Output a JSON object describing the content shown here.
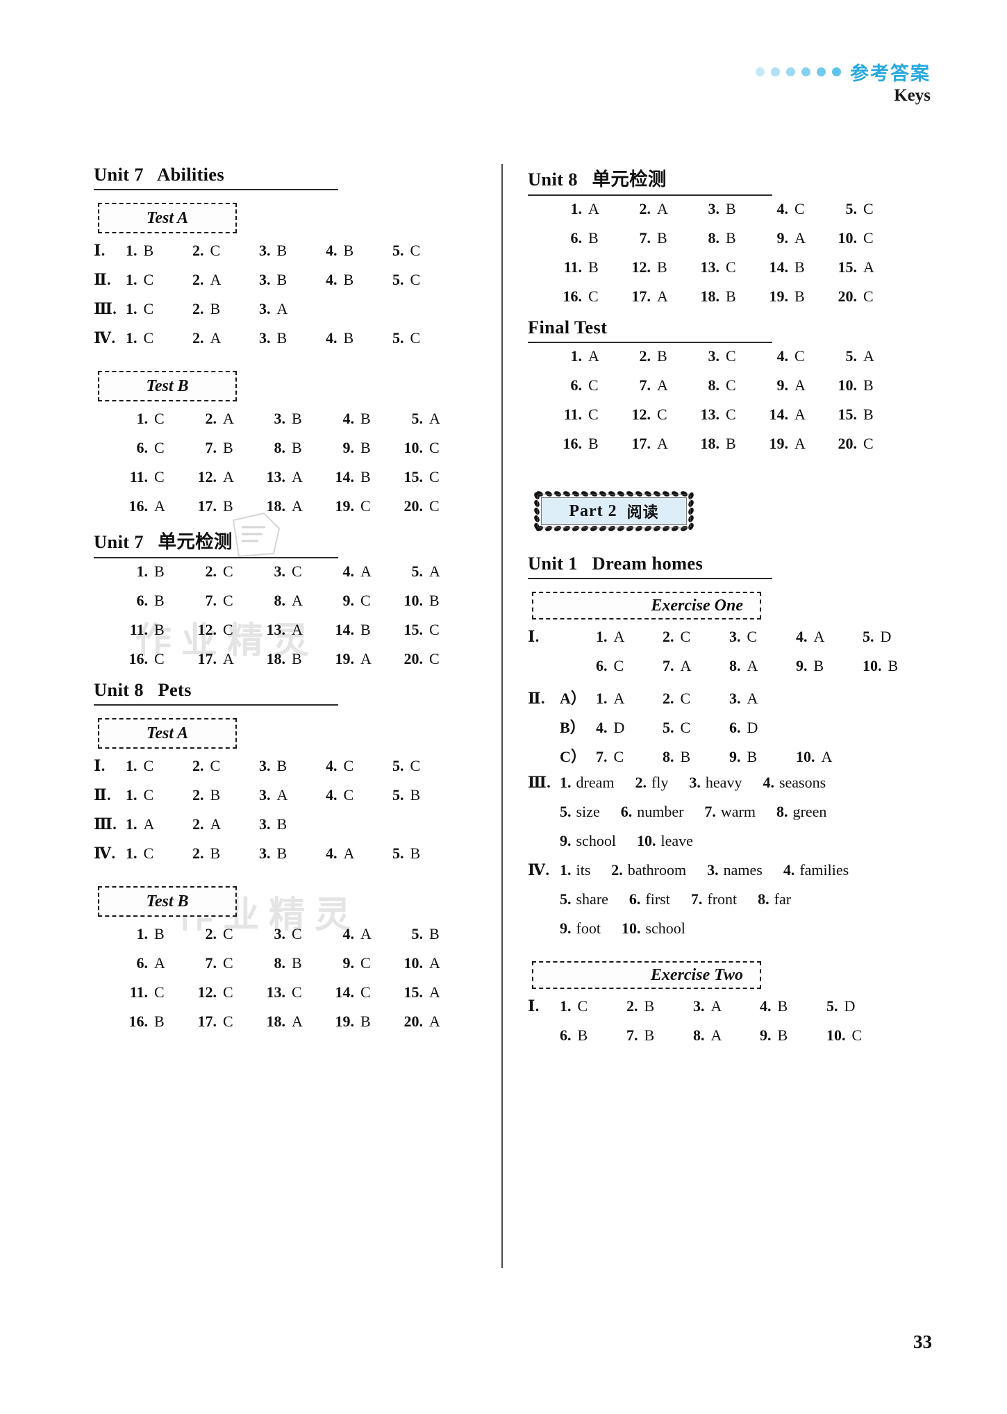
{
  "header": {
    "cn_title": "参考答案",
    "keys_label": "Keys",
    "accent_color": "#27a9e0",
    "dot_count": 6
  },
  "page_number": "33",
  "watermarks": [
    "作业精灵",
    "作业精灵",
    "作业"
  ],
  "left_column": [
    {
      "type": "unit-heading",
      "name": "unit-7-abilities",
      "text": "Unit 7   Abilities"
    },
    {
      "type": "test-label",
      "name": "test-a",
      "text": "Test A"
    },
    {
      "type": "answer-rows",
      "name": "unit7-test-a-answers",
      "rows": [
        {
          "roman": "Ⅰ.",
          "items": [
            [
              "1.",
              "B"
            ],
            [
              "2.",
              "C"
            ],
            [
              "3.",
              "B"
            ],
            [
              "4.",
              "B"
            ],
            [
              "5.",
              "C"
            ]
          ]
        },
        {
          "roman": "Ⅱ.",
          "items": [
            [
              "1.",
              "C"
            ],
            [
              "2.",
              "A"
            ],
            [
              "3.",
              "B"
            ],
            [
              "4.",
              "B"
            ],
            [
              "5.",
              "C"
            ]
          ]
        },
        {
          "roman": "Ⅲ.",
          "items": [
            [
              "1.",
              "C"
            ],
            [
              "2.",
              "B"
            ],
            [
              "3.",
              "A"
            ]
          ]
        },
        {
          "roman": "Ⅳ.",
          "items": [
            [
              "1.",
              "C"
            ],
            [
              "2.",
              "A"
            ],
            [
              "3.",
              "B"
            ],
            [
              "4.",
              "B"
            ],
            [
              "5.",
              "C"
            ]
          ]
        }
      ]
    },
    {
      "type": "test-label",
      "name": "test-b",
      "text": "Test B"
    },
    {
      "type": "grid-rows",
      "name": "unit7-test-b-answers",
      "rows": [
        [
          [
            "1.",
            "C"
          ],
          [
            "2.",
            "A"
          ],
          [
            "3.",
            "B"
          ],
          [
            "4.",
            "B"
          ],
          [
            "5.",
            "A"
          ]
        ],
        [
          [
            "6.",
            "C"
          ],
          [
            "7.",
            "B"
          ],
          [
            "8.",
            "B"
          ],
          [
            "9.",
            "B"
          ],
          [
            "10.",
            "C"
          ]
        ],
        [
          [
            "11.",
            "C"
          ],
          [
            "12.",
            "A"
          ],
          [
            "13.",
            "A"
          ],
          [
            "14.",
            "B"
          ],
          [
            "15.",
            "C"
          ]
        ],
        [
          [
            "16.",
            "A"
          ],
          [
            "17.",
            "B"
          ],
          [
            "18.",
            "A"
          ],
          [
            "19.",
            "C"
          ],
          [
            "20.",
            "C"
          ]
        ]
      ]
    },
    {
      "type": "unit-heading",
      "name": "unit-7-unit-test",
      "text": "Unit 7   单元检测"
    },
    {
      "type": "grid-rows",
      "name": "unit7-unit-test-answers",
      "rows": [
        [
          [
            "1.",
            "B"
          ],
          [
            "2.",
            "C"
          ],
          [
            "3.",
            "C"
          ],
          [
            "4.",
            "A"
          ],
          [
            "5.",
            "A"
          ]
        ],
        [
          [
            "6.",
            "B"
          ],
          [
            "7.",
            "C"
          ],
          [
            "8.",
            "A"
          ],
          [
            "9.",
            "C"
          ],
          [
            "10.",
            "B"
          ]
        ],
        [
          [
            "11.",
            "B"
          ],
          [
            "12.",
            "C"
          ],
          [
            "13.",
            "A"
          ],
          [
            "14.",
            "B"
          ],
          [
            "15.",
            "C"
          ]
        ],
        [
          [
            "16.",
            "C"
          ],
          [
            "17.",
            "A"
          ],
          [
            "18.",
            "B"
          ],
          [
            "19.",
            "A"
          ],
          [
            "20.",
            "C"
          ]
        ]
      ]
    },
    {
      "type": "unit-heading",
      "name": "unit-8-pets",
      "text": "Unit 8   Pets"
    },
    {
      "type": "test-label",
      "name": "test-a",
      "text": "Test A"
    },
    {
      "type": "answer-rows",
      "name": "unit8-test-a-answers",
      "rows": [
        {
          "roman": "Ⅰ.",
          "items": [
            [
              "1.",
              "C"
            ],
            [
              "2.",
              "C"
            ],
            [
              "3.",
              "B"
            ],
            [
              "4.",
              "C"
            ],
            [
              "5.",
              "C"
            ]
          ]
        },
        {
          "roman": "Ⅱ.",
          "items": [
            [
              "1.",
              "C"
            ],
            [
              "2.",
              "B"
            ],
            [
              "3.",
              "A"
            ],
            [
              "4.",
              "C"
            ],
            [
              "5.",
              "B"
            ]
          ]
        },
        {
          "roman": "Ⅲ.",
          "items": [
            [
              "1.",
              "A"
            ],
            [
              "2.",
              "A"
            ],
            [
              "3.",
              "B"
            ]
          ]
        },
        {
          "roman": "Ⅳ.",
          "items": [
            [
              "1.",
              "C"
            ],
            [
              "2.",
              "B"
            ],
            [
              "3.",
              "B"
            ],
            [
              "4.",
              "A"
            ],
            [
              "5.",
              "B"
            ]
          ]
        }
      ]
    },
    {
      "type": "test-label",
      "name": "test-b",
      "text": "Test B"
    },
    {
      "type": "grid-rows",
      "name": "unit8-test-b-answers",
      "rows": [
        [
          [
            "1.",
            "B"
          ],
          [
            "2.",
            "C"
          ],
          [
            "3.",
            "C"
          ],
          [
            "4.",
            "A"
          ],
          [
            "5.",
            "B"
          ]
        ],
        [
          [
            "6.",
            "A"
          ],
          [
            "7.",
            "C"
          ],
          [
            "8.",
            "B"
          ],
          [
            "9.",
            "C"
          ],
          [
            "10.",
            "A"
          ]
        ],
        [
          [
            "11.",
            "C"
          ],
          [
            "12.",
            "C"
          ],
          [
            "13.",
            "C"
          ],
          [
            "14.",
            "C"
          ],
          [
            "15.",
            "A"
          ]
        ],
        [
          [
            "16.",
            "B"
          ],
          [
            "17.",
            "C"
          ],
          [
            "18.",
            "A"
          ],
          [
            "19.",
            "B"
          ],
          [
            "20.",
            "A"
          ]
        ]
      ]
    }
  ],
  "right_column": [
    {
      "type": "unit-heading",
      "name": "unit-8-unit-test",
      "text": "Unit 8   单元检测"
    },
    {
      "type": "grid-rows",
      "name": "unit8-unit-test-answers",
      "rows": [
        [
          [
            "1.",
            "A"
          ],
          [
            "2.",
            "A"
          ],
          [
            "3.",
            "B"
          ],
          [
            "4.",
            "C"
          ],
          [
            "5.",
            "C"
          ]
        ],
        [
          [
            "6.",
            "B"
          ],
          [
            "7.",
            "B"
          ],
          [
            "8.",
            "B"
          ],
          [
            "9.",
            "A"
          ],
          [
            "10.",
            "C"
          ]
        ],
        [
          [
            "11.",
            "B"
          ],
          [
            "12.",
            "B"
          ],
          [
            "13.",
            "C"
          ],
          [
            "14.",
            "B"
          ],
          [
            "15.",
            "A"
          ]
        ],
        [
          [
            "16.",
            "C"
          ],
          [
            "17.",
            "A"
          ],
          [
            "18.",
            "B"
          ],
          [
            "19.",
            "B"
          ],
          [
            "20.",
            "C"
          ]
        ]
      ]
    },
    {
      "type": "unit-heading",
      "name": "final-test",
      "text": "Final Test"
    },
    {
      "type": "grid-rows",
      "name": "final-test-answers",
      "rows": [
        [
          [
            "1.",
            "A"
          ],
          [
            "2.",
            "B"
          ],
          [
            "3.",
            "C"
          ],
          [
            "4.",
            "C"
          ],
          [
            "5.",
            "A"
          ]
        ],
        [
          [
            "6.",
            "C"
          ],
          [
            "7.",
            "A"
          ],
          [
            "8.",
            "C"
          ],
          [
            "9.",
            "A"
          ],
          [
            "10.",
            "B"
          ]
        ],
        [
          [
            "11.",
            "C"
          ],
          [
            "12.",
            "C"
          ],
          [
            "13.",
            "C"
          ],
          [
            "14.",
            "A"
          ],
          [
            "15.",
            "B"
          ]
        ],
        [
          [
            "16.",
            "B"
          ],
          [
            "17.",
            "A"
          ],
          [
            "18.",
            "B"
          ],
          [
            "19.",
            "A"
          ],
          [
            "20.",
            "C"
          ]
        ]
      ]
    },
    {
      "type": "part-banner",
      "name": "part-2-banner",
      "label": "Part 2",
      "cn": "阅读",
      "fill_color": "#ddeef8"
    },
    {
      "type": "unit-heading",
      "name": "unit-1-dream-homes",
      "text": "Unit 1   Dream homes"
    },
    {
      "type": "test-label",
      "name": "exercise-one",
      "text": "Exercise One"
    },
    {
      "type": "answer-rows",
      "name": "exercise-one-answers",
      "rows": [
        {
          "roman": "Ⅰ.",
          "items": [
            [
              "1.",
              "A"
            ],
            [
              "2.",
              "C"
            ],
            [
              "3.",
              "C"
            ],
            [
              "4.",
              "A"
            ],
            [
              "5.",
              "D"
            ]
          ]
        },
        {
          "roman": "",
          "items": [
            [
              "6.",
              "C"
            ],
            [
              "7.",
              "A"
            ],
            [
              "8.",
              "A"
            ],
            [
              "9.",
              "B"
            ],
            [
              "10.",
              "B"
            ]
          ]
        },
        {
          "roman": "Ⅱ.",
          "sub": "A）",
          "items": [
            [
              "1.",
              "A"
            ],
            [
              "2.",
              "C"
            ],
            [
              "3.",
              "A"
            ]
          ]
        },
        {
          "roman": "",
          "sub": "B）",
          "items": [
            [
              "4.",
              "D"
            ],
            [
              "5.",
              "C"
            ],
            [
              "6.",
              "D"
            ]
          ]
        },
        {
          "roman": "",
          "sub": "C）",
          "items": [
            [
              "7.",
              "C"
            ],
            [
              "8.",
              "B"
            ],
            [
              "9.",
              "B"
            ],
            [
              "10.",
              "A"
            ]
          ]
        }
      ]
    },
    {
      "type": "word-rows",
      "name": "exercise-one-word-answers",
      "rows": [
        {
          "roman": "Ⅲ.",
          "items": [
            [
              "1.",
              "dream"
            ],
            [
              "2.",
              "fly"
            ],
            [
              "3.",
              "heavy"
            ],
            [
              "4.",
              "seasons"
            ]
          ]
        },
        {
          "roman": "",
          "items": [
            [
              "5.",
              "size"
            ],
            [
              "6.",
              "number"
            ],
            [
              "7.",
              "warm"
            ],
            [
              "8.",
              "green"
            ]
          ]
        },
        {
          "roman": "",
          "items": [
            [
              "9.",
              "school"
            ],
            [
              "10.",
              "leave"
            ]
          ]
        },
        {
          "roman": "Ⅳ.",
          "items": [
            [
              "1.",
              "its"
            ],
            [
              "2.",
              "bathroom"
            ],
            [
              "3.",
              "names"
            ],
            [
              "4.",
              "families"
            ]
          ]
        },
        {
          "roman": "",
          "items": [
            [
              "5.",
              "share"
            ],
            [
              "6.",
              "first"
            ],
            [
              "7.",
              "front"
            ],
            [
              "8.",
              "far"
            ]
          ]
        },
        {
          "roman": "",
          "items": [
            [
              "9.",
              "foot"
            ],
            [
              "10.",
              "school"
            ]
          ]
        }
      ]
    },
    {
      "type": "test-label",
      "name": "exercise-two",
      "text": "Exercise Two"
    },
    {
      "type": "answer-rows",
      "name": "exercise-two-answers",
      "rows": [
        {
          "roman": "Ⅰ.",
          "items": [
            [
              "1.",
              "C"
            ],
            [
              "2.",
              "B"
            ],
            [
              "3.",
              "A"
            ],
            [
              "4.",
              "B"
            ],
            [
              "5.",
              "D"
            ]
          ]
        },
        {
          "roman": "",
          "items": [
            [
              "6.",
              "B"
            ],
            [
              "7.",
              "B"
            ],
            [
              "8.",
              "A"
            ],
            [
              "9.",
              "B"
            ],
            [
              "10.",
              "C"
            ]
          ]
        }
      ]
    }
  ]
}
